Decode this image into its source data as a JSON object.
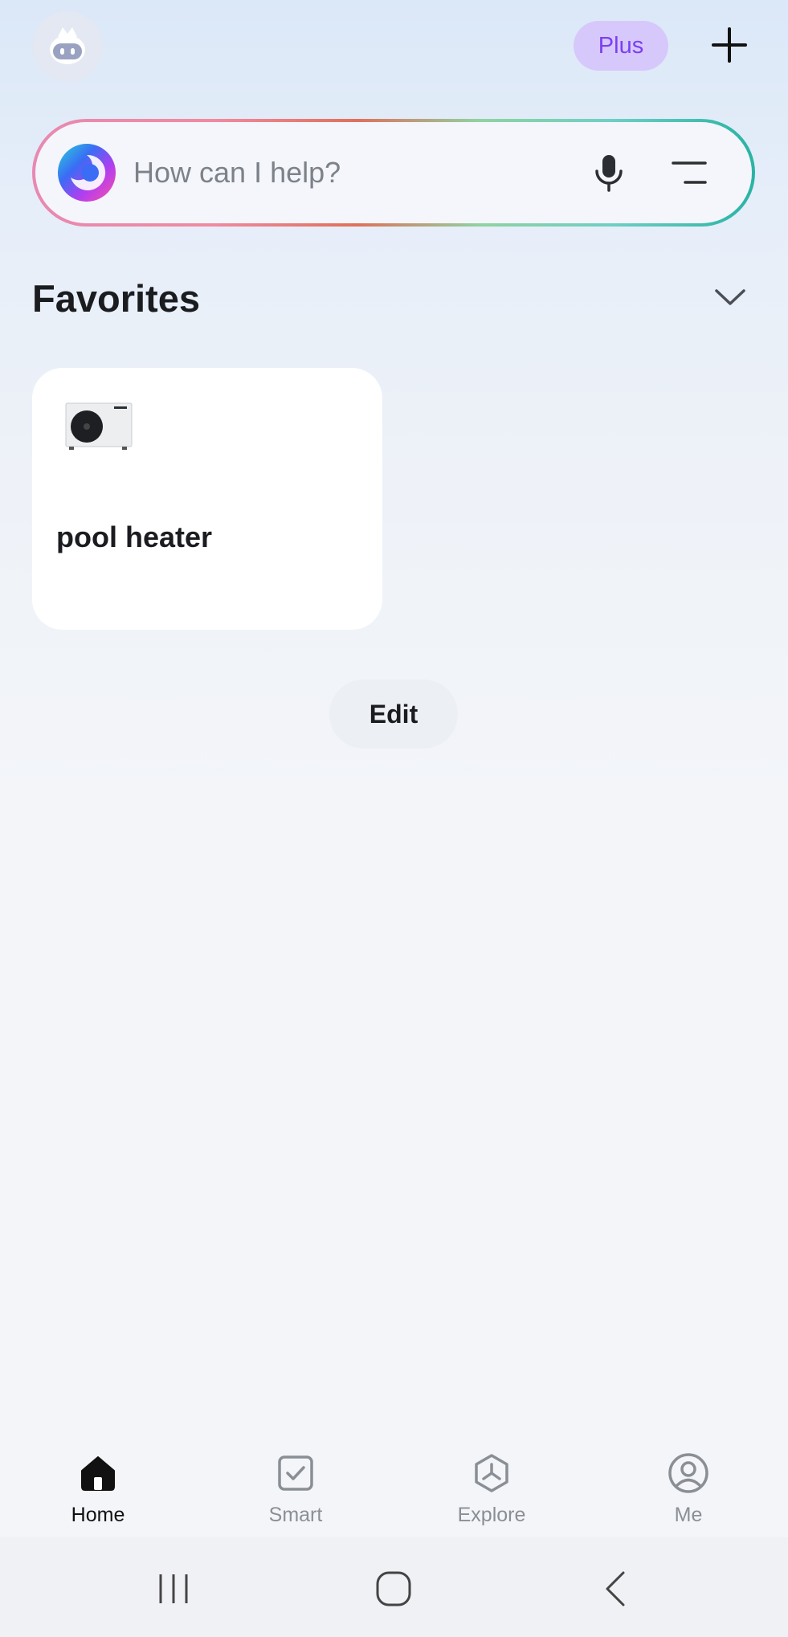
{
  "header": {
    "plus_label": "Plus",
    "icons": {
      "avatar": "robot-avatar-icon",
      "add": "plus-icon"
    }
  },
  "search": {
    "placeholder": "How can I help?",
    "icons": {
      "logo": "ai-assistant-logo",
      "mic": "microphone-icon",
      "menu": "menu-lines-icon"
    }
  },
  "favorites": {
    "title": "Favorites",
    "chevron_icon": "chevron-down-icon",
    "devices": [
      {
        "name": "pool heater",
        "image": "heat-pump-unit-image"
      }
    ],
    "edit_label": "Edit"
  },
  "tabbar": {
    "tabs": [
      {
        "label": "Home",
        "icon": "home-icon",
        "active": true
      },
      {
        "label": "Smart",
        "icon": "checkbox-icon",
        "active": false
      },
      {
        "label": "Explore",
        "icon": "explore-hexagon-icon",
        "active": false
      },
      {
        "label": "Me",
        "icon": "profile-icon",
        "active": false
      }
    ]
  },
  "system_nav": {
    "icons": [
      "recent-apps-icon",
      "home-circle-icon",
      "back-icon"
    ]
  },
  "colors": {
    "accent_purple": "#7b3ff2",
    "plus_bg": "#d7c8fb",
    "card_bg": "#ffffff",
    "text_primary": "#1a1c20",
    "text_muted": "#8a8f96"
  }
}
